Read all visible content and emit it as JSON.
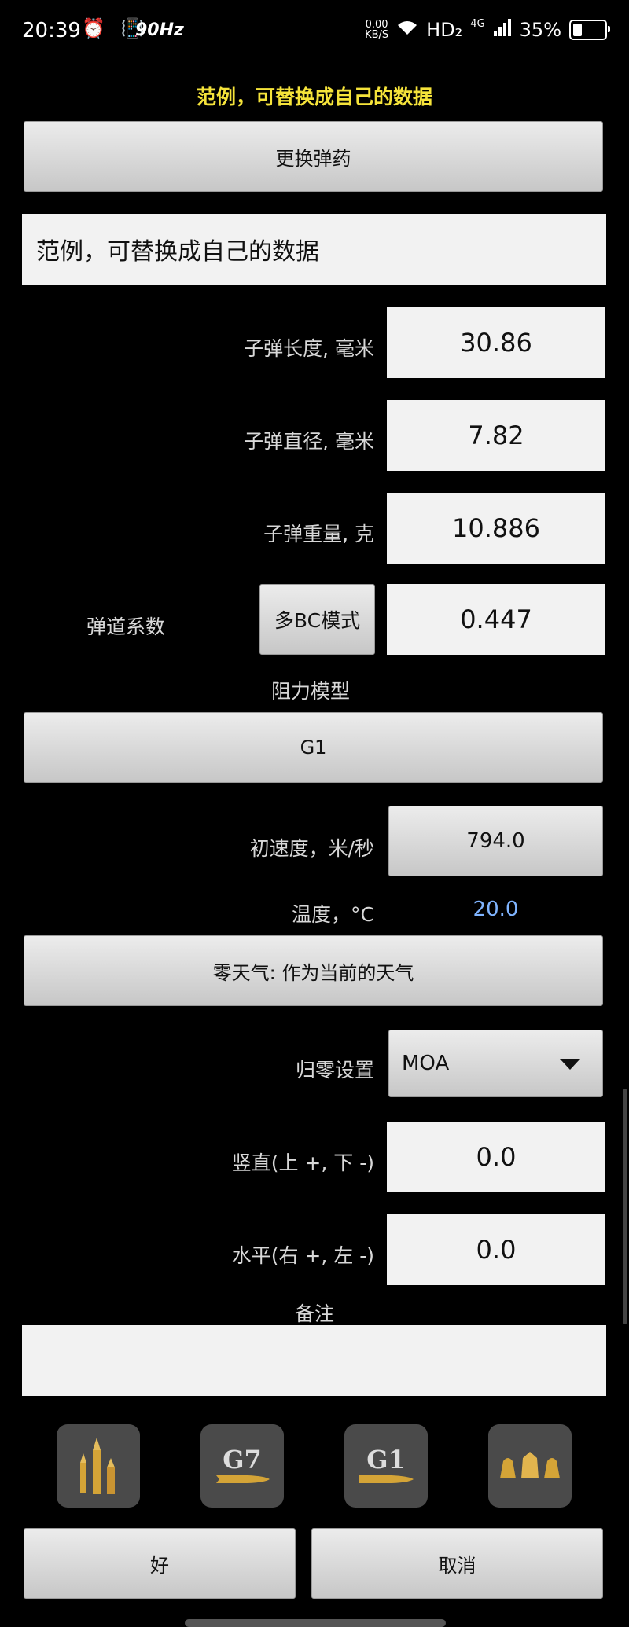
{
  "status_bar": {
    "time": "20:39",
    "left_icons": "⏰ 📳",
    "refresh_rate": "90Hz",
    "net_speed_value": "0.00",
    "net_speed_unit": "KB/S",
    "hd_label": "HD₂",
    "signal": "4G",
    "battery": "35%"
  },
  "header": {
    "caption": "范例，可替换成自己的数据"
  },
  "buttons": {
    "change_ammo": "更换弹药",
    "multi_bc": "多BC模式",
    "drag_model_value": "G1",
    "zero_weather": "零天气: 作为当前的天气",
    "ok": "好",
    "cancel": "取消"
  },
  "name_field": {
    "value": "范例，可替换成自己的数据"
  },
  "fields": {
    "bullet_length": {
      "label": "子弹长度, 毫米",
      "value": "30.86"
    },
    "bullet_diameter": {
      "label": "子弹直径, 毫米",
      "value": "7.82"
    },
    "bullet_weight": {
      "label": "子弹重量, 克",
      "value": "10.886"
    },
    "ballistic_coefficient": {
      "label": "弹道系数",
      "value": "0.447"
    },
    "drag_model": {
      "label": "阻力模型"
    },
    "muzzle_velocity": {
      "label": "初速度，米/秒",
      "value": "794.0"
    },
    "temperature": {
      "label": "温度，°C",
      "value": "20.0"
    },
    "zero_setting": {
      "label": "归零设置",
      "value": "MOA"
    },
    "vertical": {
      "label": "竖直(上 +, 下 -)",
      "value": "0.0"
    },
    "horizontal": {
      "label": "水平(右 +, 左 -)",
      "value": "0.0"
    },
    "notes": {
      "label": "备注",
      "value": ""
    }
  },
  "toolbar_icons": {
    "g7_label": "G7",
    "g1_label": "G1"
  },
  "colors": {
    "caption": "#f5e33a",
    "temperature_value": "#7fb4ff",
    "bullet_brass": "#d4a437"
  }
}
